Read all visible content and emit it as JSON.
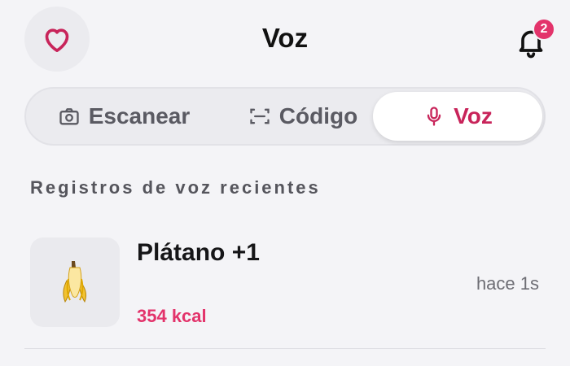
{
  "header": {
    "title": "Voz",
    "notification_count": "2",
    "favorite_icon": "heart-icon",
    "notification_icon": "bell-icon"
  },
  "tabs": [
    {
      "label": "Escanear",
      "icon": "camera-icon",
      "selected": false
    },
    {
      "label": "Código",
      "icon": "scan-frame-icon",
      "selected": false
    },
    {
      "label": "Voz",
      "icon": "microphone-icon",
      "selected": true
    }
  ],
  "section": {
    "title": "Registros de voz recientes"
  },
  "logs": [
    {
      "name": "Plátano +1",
      "kcal": "354 kcal",
      "time": "hace 1s",
      "icon": "banana-icon"
    }
  ],
  "colors": {
    "accent": "#e3336b",
    "selected_text": "#c8245a",
    "background": "#f4f4f7",
    "muted": "#5a5a62"
  }
}
